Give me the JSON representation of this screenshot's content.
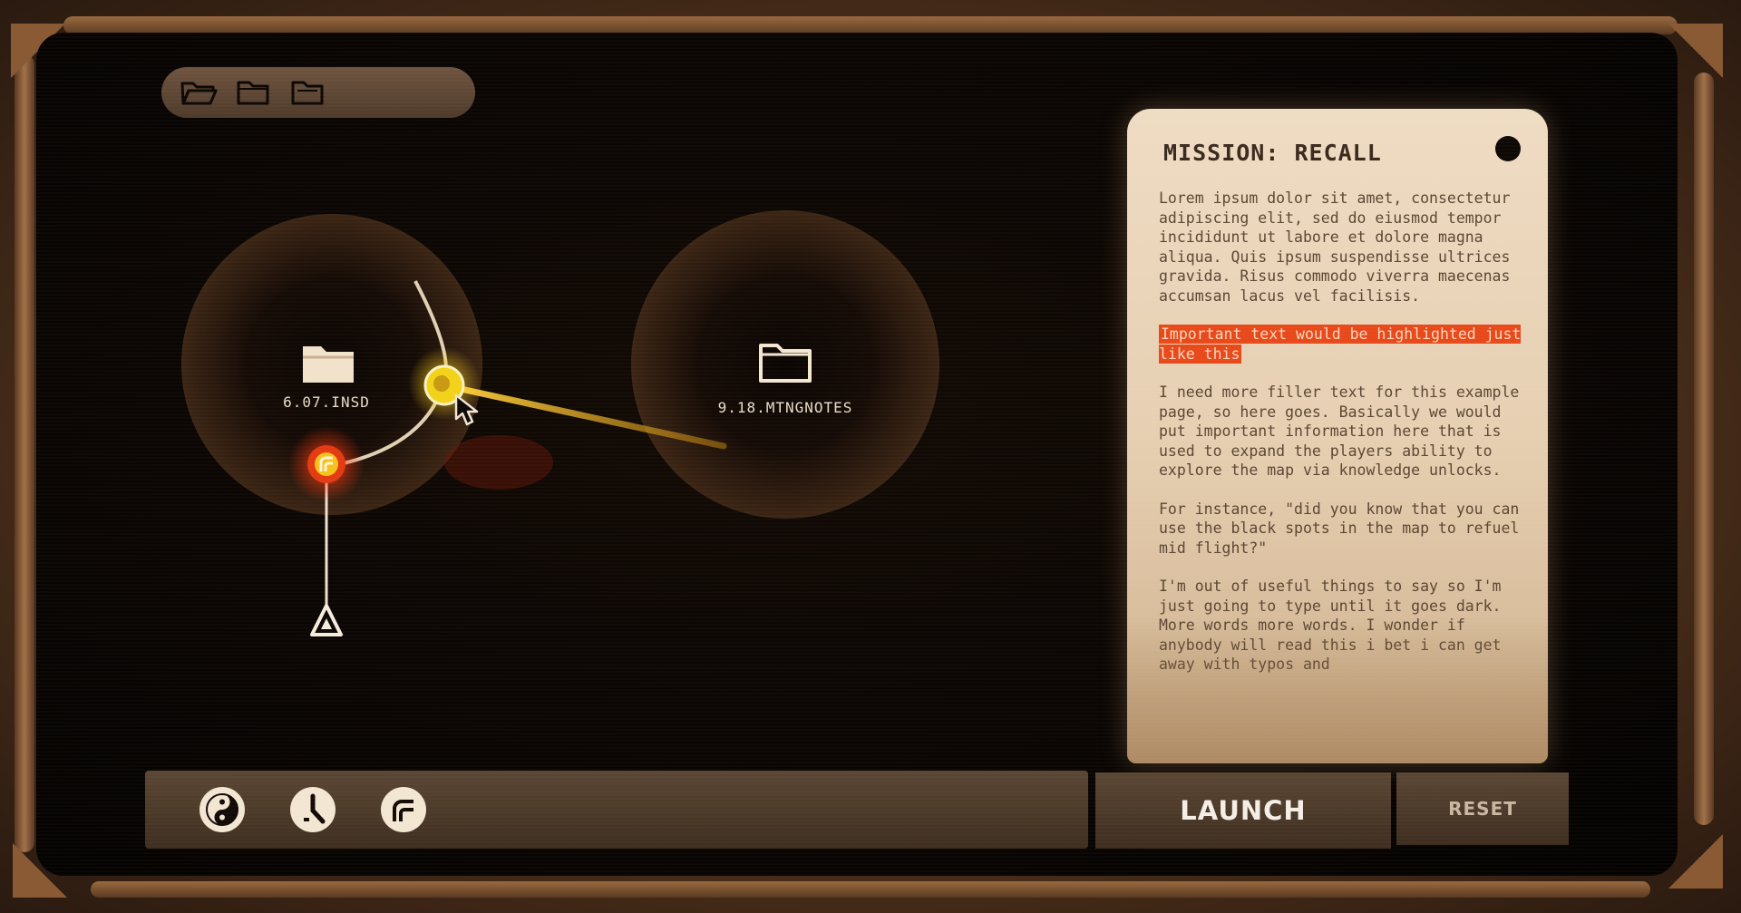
{
  "toolbar": {
    "folders": [
      "folder-open-icon",
      "folder-icon",
      "folder-icon"
    ]
  },
  "map": {
    "nodes": [
      {
        "label": "6.07.INSD",
        "icon": "folder-open-icon",
        "state": "visited"
      },
      {
        "label": "9.18.MTNGNOTES",
        "icon": "folder-icon",
        "state": "target"
      }
    ],
    "markers": {
      "player": "player-ship-icon",
      "selected_waypoint": "waypoint-red-icon",
      "cursor_waypoint": "waypoint-yellow-icon",
      "start": "triangle-start-icon"
    }
  },
  "panel": {
    "title": "MISSION: RECALL",
    "paragraph1": "Lorem ipsum dolor sit amet, consectetur adipiscing elit, sed do eiusmod tempor incididunt ut labore et dolore magna aliqua. Quis ipsum suspendisse ultrices gravida. Risus commodo viverra maecenas accumsan lacus vel facilisis.",
    "highlight": "Important text would be highlighted just like this",
    "paragraph2": "I need more filler text for this example page, so here goes. Basically we would put important information here that is used to expand the players ability to explore the map via knowledge unlocks.",
    "paragraph3": "For instance, \"did you know that you can use the black spots in the map to refuel mid flight?\"",
    "paragraph4": "I'm out of useful things to say so I'm just going to type until it goes dark. More words more words. I wonder if anybody will read this i bet i can get away with typos and"
  },
  "bottom": {
    "tools": [
      "yin-yang-icon",
      "clock-icon",
      "curve-icon"
    ],
    "launch": "LAUNCH",
    "reset": "RESET"
  },
  "colors": {
    "accent_orange": "#e8491a",
    "waypoint_yellow": "#f2d21a",
    "waypoint_red": "#e33a12",
    "panel_bg": "#e6cfb2"
  }
}
